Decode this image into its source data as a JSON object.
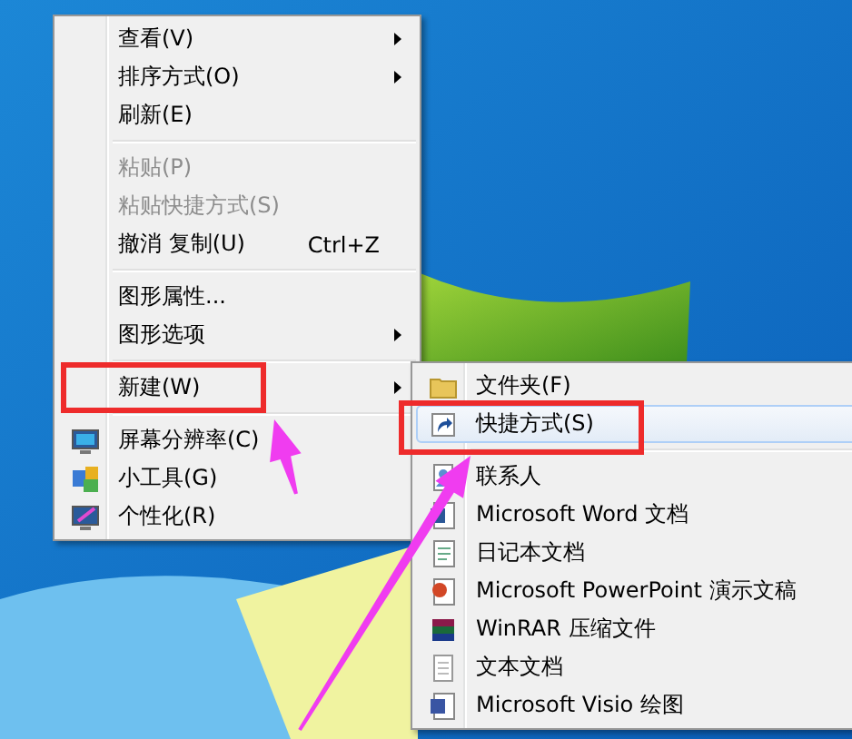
{
  "context_menu": {
    "items": [
      {
        "kind": "item",
        "label": "查看(V)",
        "submenu": true,
        "disabled": false
      },
      {
        "kind": "item",
        "label": "排序方式(O)",
        "submenu": true,
        "disabled": false
      },
      {
        "kind": "item",
        "label": "刷新(E)",
        "submenu": false,
        "disabled": false
      },
      {
        "kind": "separator"
      },
      {
        "kind": "item",
        "label": "粘贴(P)",
        "submenu": false,
        "disabled": true
      },
      {
        "kind": "item",
        "label": "粘贴快捷方式(S)",
        "submenu": false,
        "disabled": true
      },
      {
        "kind": "item",
        "label": "撤消 复制(U)",
        "shortcut": "Ctrl+Z",
        "submenu": false,
        "disabled": false
      },
      {
        "kind": "separator"
      },
      {
        "kind": "item",
        "label": "图形属性...",
        "submenu": false,
        "disabled": false
      },
      {
        "kind": "item",
        "label": "图形选项",
        "submenu": true,
        "disabled": false
      },
      {
        "kind": "separator"
      },
      {
        "kind": "item",
        "label": "新建(W)",
        "submenu": true,
        "disabled": false,
        "annotated": true
      },
      {
        "kind": "separator"
      },
      {
        "kind": "item",
        "label": "屏幕分辨率(C)",
        "submenu": false,
        "disabled": false
      },
      {
        "kind": "item",
        "label": "小工具(G)",
        "submenu": false,
        "disabled": false
      },
      {
        "kind": "item",
        "label": "个性化(R)",
        "submenu": false,
        "disabled": false
      }
    ]
  },
  "new_submenu": {
    "items": [
      {
        "kind": "item",
        "label": "文件夹(F)",
        "selected": false,
        "annotated": false
      },
      {
        "kind": "item",
        "label": "快捷方式(S)",
        "selected": true,
        "annotated": true
      },
      {
        "kind": "separator"
      },
      {
        "kind": "item",
        "label": "联系人",
        "selected": false,
        "annotated": false
      },
      {
        "kind": "item",
        "label": "Microsoft Word 文档",
        "selected": false,
        "annotated": false
      },
      {
        "kind": "item",
        "label": "日记本文档",
        "selected": false,
        "annotated": false
      },
      {
        "kind": "item",
        "label": "Microsoft PowerPoint 演示文稿",
        "selected": false,
        "annotated": false
      },
      {
        "kind": "item",
        "label": "WinRAR 压缩文件",
        "selected": false,
        "annotated": false
      },
      {
        "kind": "item",
        "label": "文本文档",
        "selected": false,
        "annotated": false
      },
      {
        "kind": "item",
        "label": "Microsoft Visio 绘图",
        "selected": false,
        "annotated": false
      }
    ]
  }
}
